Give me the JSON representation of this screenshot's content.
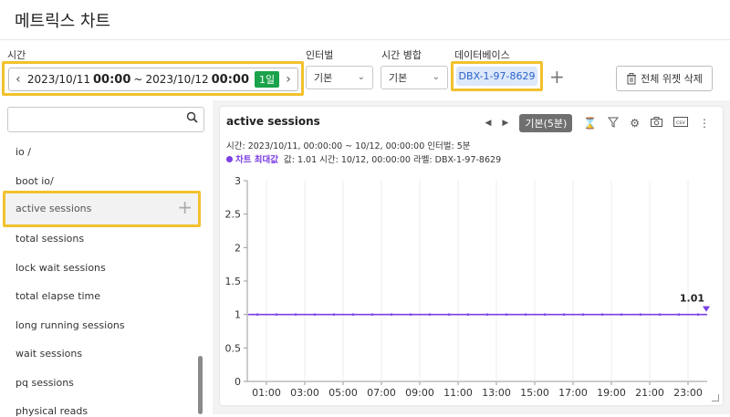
{
  "app": {
    "title": "메트릭스 차트"
  },
  "toolbar": {
    "time_label": "시간",
    "time_from_date": "2023/10/11",
    "time_from_hm": "00:00",
    "tilde": "~",
    "time_to_date": "2023/10/12",
    "time_to_hm": "00:00",
    "range_badge": "1일",
    "prev_icon": "chevron-left-icon",
    "next_icon": "chevron-right-icon",
    "interval_label": "인터벌",
    "interval_value": "기본",
    "merge_label": "시간 병합",
    "merge_value": "기본",
    "db_label": "데이터베이스",
    "db_value": "DBX-1-97-8629",
    "add_icon": "plus-icon",
    "delete_all_label": "전체 위젯 삭제",
    "delete_icon": "trash-icon"
  },
  "sidebar": {
    "search_placeholder": "",
    "search_icon": "search-icon",
    "items": [
      {
        "label": "io /"
      },
      {
        "label": "boot io/"
      },
      {
        "label": "active sessions",
        "selected": true
      },
      {
        "label": "total sessions"
      },
      {
        "label": "lock wait sessions"
      },
      {
        "label": "total elapse time"
      },
      {
        "label": "long running sessions"
      },
      {
        "label": "wait sessions"
      },
      {
        "label": "pq sessions"
      },
      {
        "label": "physical reads"
      }
    ],
    "add_icon": "plus-icon"
  },
  "widget": {
    "title": "active sessions",
    "interval_chip": "기본(5분)",
    "tool_icons": [
      "caret-left-icon",
      "caret-right-icon",
      "hourglass-icon",
      "filter-icon",
      "gear-icon",
      "camera-icon",
      "csv-icon",
      "more-vertical-icon"
    ],
    "info_line1": "시간: 2023/10/11, 00:00:00 ~ 10/12, 00:00:00   인터벌: 5분",
    "legend_name": "차트 최대값",
    "info_line2_rest": "값: 1.01   시간: 10/12, 00:00:00   라벨: DBX-1-97-8629",
    "accent": "#7b3fe4"
  },
  "chart_data": {
    "type": "line",
    "title": "active sessions",
    "ylim": [
      0,
      3
    ],
    "yticks": [
      "0",
      "0.5",
      "1",
      "1.5",
      "2",
      "2.5",
      "3"
    ],
    "xticks": [
      "01:00",
      "03:00",
      "05:00",
      "07:00",
      "09:00",
      "11:00",
      "13:00",
      "15:00",
      "17:00",
      "19:00",
      "21:00",
      "23:00"
    ],
    "series": [
      {
        "name": "DBX-1-97-8629",
        "color": "#7b3fe4",
        "x_start": "00:00",
        "x_end": "24:00",
        "value": 1.0
      }
    ],
    "max_label": "1.01",
    "grid": "vertical"
  }
}
